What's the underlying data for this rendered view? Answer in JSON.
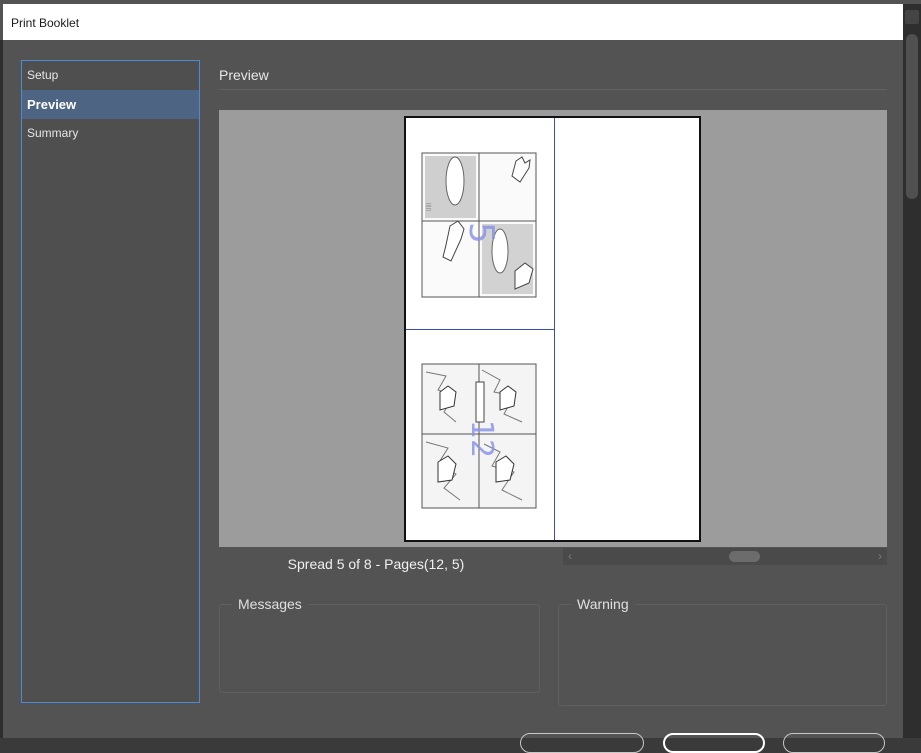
{
  "window": {
    "title": "Print Booklet"
  },
  "sidebar": {
    "items": [
      {
        "label": "Setup",
        "active": false
      },
      {
        "label": "Preview",
        "active": true
      },
      {
        "label": "Summary",
        "active": false
      }
    ]
  },
  "main": {
    "section_title": "Preview",
    "spread_label": "Spread 5 of 8 - Pages(12, 5)",
    "messages_label": "Messages",
    "warning_label": "Warning"
  },
  "preview": {
    "top_page_number": "5",
    "bottom_page_number": "12"
  },
  "scrollbar": {
    "left_arrow": "‹",
    "right_arrow": "›"
  },
  "colors": {
    "accent": "#4a8ad6",
    "selection": "#4d6582",
    "page_guides": "#3b4bbd"
  }
}
